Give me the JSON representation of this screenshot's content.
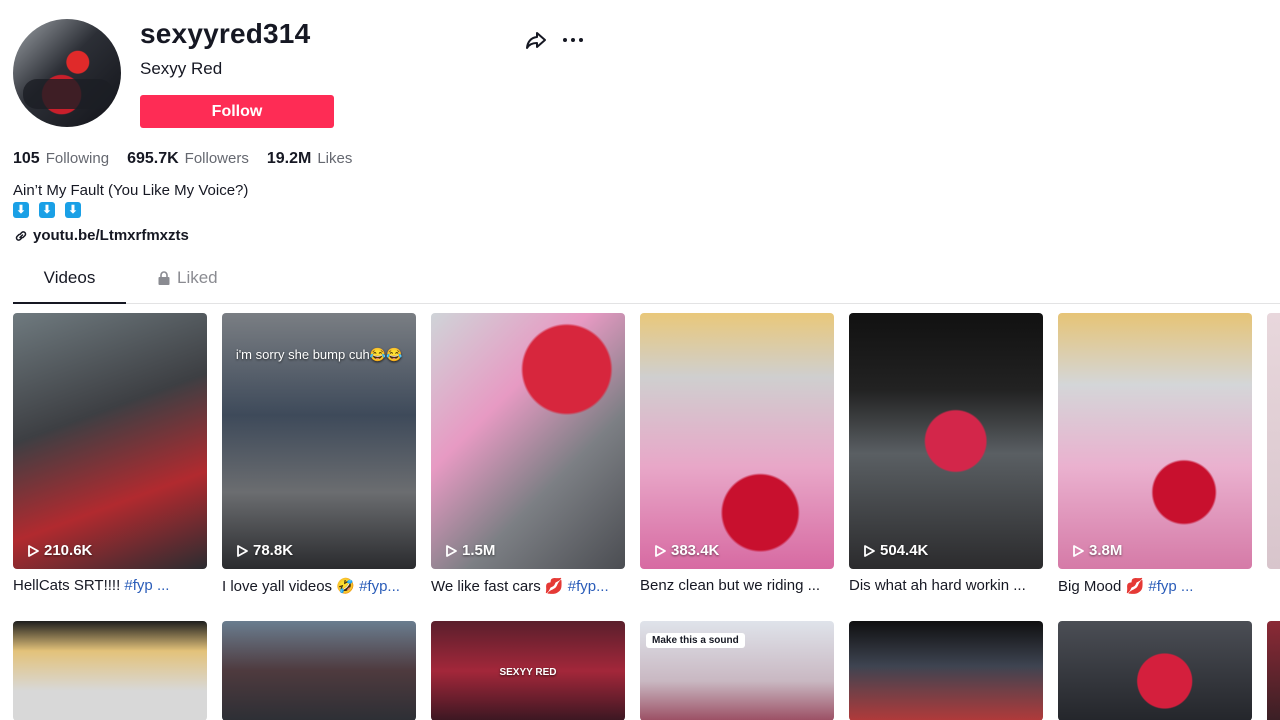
{
  "profile": {
    "username": "sexyyred314",
    "nickname": "Sexyy Red",
    "follow_label": "Follow",
    "stats": {
      "following": {
        "value": "105",
        "label": "Following"
      },
      "followers": {
        "value": "695.7K",
        "label": "Followers"
      },
      "likes": {
        "value": "19.2M",
        "label": "Likes"
      }
    },
    "bio": "Ain’t My Fault (You Like My Voice?)",
    "bio_icons": [
      "⬇",
      "⬇",
      "⬇"
    ],
    "link": "youtu.be/Ltmxrfmxzts"
  },
  "tabs": {
    "videos": "Videos",
    "liked": "Liked"
  },
  "videos": [
    {
      "views": "210.6K",
      "caption": "HellCats SRT!!!! ",
      "tag": "#fyp ...",
      "overlay": ""
    },
    {
      "views": "78.8K",
      "caption": "I love yall videos 🤣 ",
      "tag": "#fyp...",
      "overlay": "i'm sorry she bump cuh😂😂"
    },
    {
      "views": "1.5M",
      "caption": "We like fast cars 💋 ",
      "tag": "#fyp...",
      "overlay": ""
    },
    {
      "views": "383.4K",
      "caption": "Benz clean but we riding ...",
      "tag": "",
      "overlay": ""
    },
    {
      "views": "504.4K",
      "caption": "Dis what ah hard workin ...",
      "tag": "",
      "overlay": ""
    },
    {
      "views": "3.8M",
      "caption": "Big Mood 💋 ",
      "tag": "#fyp ...",
      "overlay": ""
    }
  ],
  "row2_overlays": [
    "",
    "",
    "SEXYY RED",
    "Make this a sound",
    "",
    ""
  ],
  "colors": {
    "brand": "#fe2c55",
    "hashtag": "#2b5db9",
    "muted": "#656870"
  }
}
